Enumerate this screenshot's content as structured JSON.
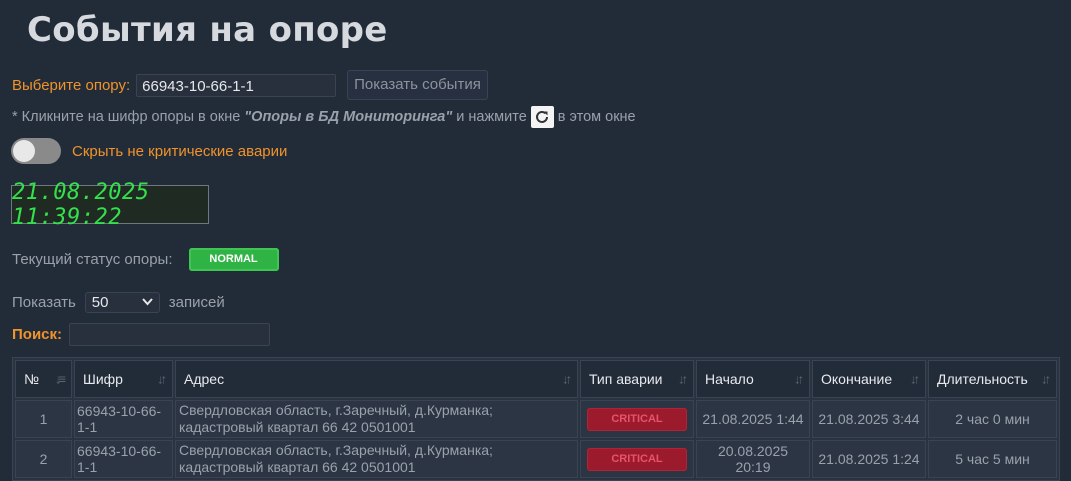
{
  "page": {
    "title": "События на опоре"
  },
  "select": {
    "label": "Выберите опору:",
    "value": "66943-10-66-1-1",
    "button": "Показать события"
  },
  "hint": {
    "prefix": "* Кликните на шифр опоры в окне ",
    "window_name": "\"Опоры в БД Мониторинга\"",
    "middle": " и нажмите",
    "suffix": "в этом окне"
  },
  "toggle": {
    "label": "Скрыть не критические аварии",
    "on": false
  },
  "clock": {
    "value": "21.08.2025 11:39:22"
  },
  "status": {
    "label": "Текущий статус опоры:",
    "value": "NORMAL",
    "color": "#2fb344"
  },
  "paging": {
    "show_label": "Показать",
    "count": "50",
    "records_label": "записей"
  },
  "search": {
    "label": "Поиск:",
    "value": ""
  },
  "table": {
    "columns": [
      "№",
      "Шифр",
      "Адрес",
      "Тип аварии",
      "Начало",
      "Окончание",
      "Длительность"
    ],
    "rows": [
      {
        "num": "1",
        "code": "66943-10-66-1-1",
        "address": "Свердловская область, г.Заречный, д.Курманка; кадастровый квартал 66 42 0501001",
        "type": "CRITICAL",
        "start": "21.08.2025 1:44",
        "end": "21.08.2025 3:44",
        "duration": "2 час 0 мин"
      },
      {
        "num": "2",
        "code": "66943-10-66-1-1",
        "address": "Свердловская область, г.Заречный, д.Курманка; кадастровый квартал 66 42 0501001",
        "type": "CRITICAL",
        "start": "20.08.2025 20:19",
        "end": "21.08.2025 1:24",
        "duration": "5 час 5 мин"
      }
    ]
  },
  "colors": {
    "accent": "#f0932b",
    "critical": "#9b1b2c",
    "clock": "#35e04e"
  }
}
